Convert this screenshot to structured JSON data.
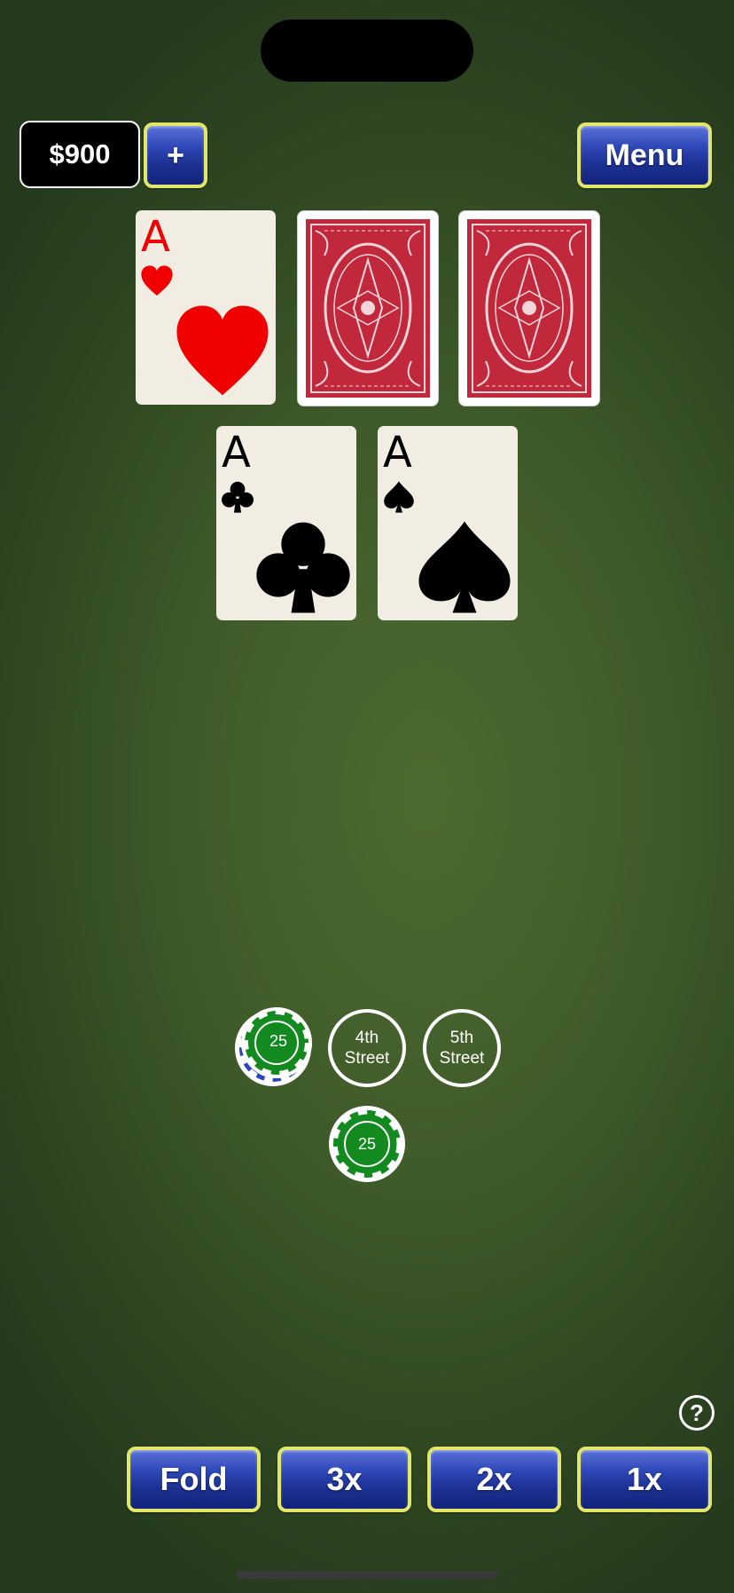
{
  "balance": "$900",
  "top_buttons": {
    "add_label": "+",
    "menu_label": "Menu"
  },
  "dealer_cards": [
    {
      "rank": "A",
      "suit": "heart",
      "color": "red",
      "face_up": true
    },
    {
      "face_up": false
    },
    {
      "face_up": false
    }
  ],
  "player_cards": [
    {
      "rank": "A",
      "suit": "club",
      "color": "black",
      "face_up": true
    },
    {
      "rank": "A",
      "suit": "spade",
      "color": "black",
      "face_up": true
    }
  ],
  "bet_spots": {
    "third_street_chip": "25",
    "fourth_street_label_1": "4th",
    "fourth_street_label_2": "Street",
    "fifth_street_label_1": "5th",
    "fifth_street_label_2": "Street",
    "ante_chip": "25"
  },
  "actions": {
    "fold": "Fold",
    "raise_3x": "3x",
    "raise_2x": "2x",
    "raise_1x": "1x"
  },
  "help_label": "?",
  "colors": {
    "felt": "#4d6a31",
    "button_blue": "#1c3193",
    "button_border": "#e2e66a",
    "chip_green": "#138a1f",
    "red_suit": "#f00000"
  }
}
